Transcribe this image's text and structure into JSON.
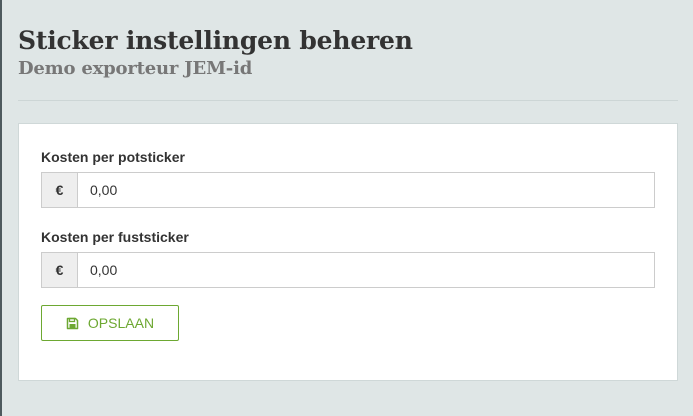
{
  "header": {
    "title": "Sticker instellingen beheren",
    "subtitle": "Demo exporteur JEM-id"
  },
  "form": {
    "fields": [
      {
        "label": "Kosten per potsticker",
        "currency_symbol": "€",
        "value": "0,00"
      },
      {
        "label": "Kosten per fuststicker",
        "currency_symbol": "€",
        "value": "0,00"
      }
    ],
    "save_button": {
      "label": "OPSLAAN",
      "icon": "save-icon"
    }
  },
  "colors": {
    "background": "#dfe6e6",
    "panel": "#ffffff",
    "accent_green": "#6da832",
    "text": "#333333",
    "muted_text": "#777777"
  }
}
